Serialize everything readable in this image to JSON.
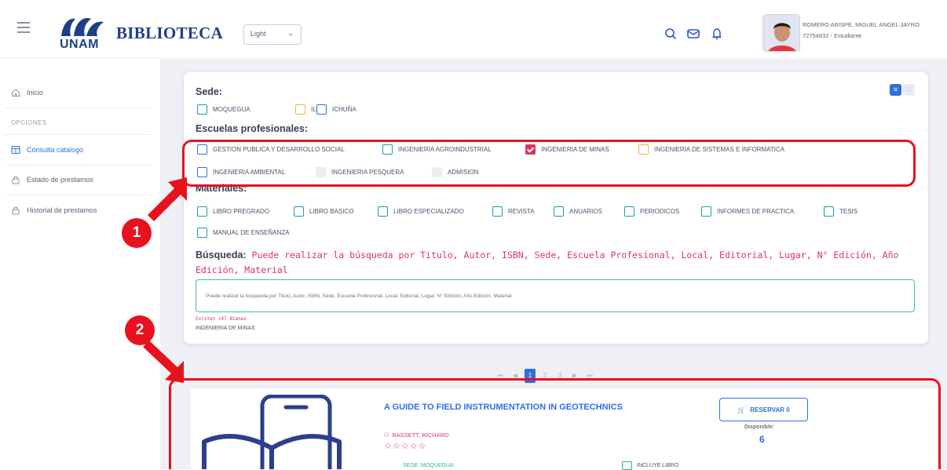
{
  "header": {
    "brand": "BIBLIOTECA",
    "logo_text": "UNAM",
    "theme_select": "Light",
    "user_name": "ROMERO ARISPE, MIGUEL ANGEL JAYRO",
    "user_id": "72754832 - Estudiante",
    "icons": [
      "search-icon",
      "mail-icon",
      "bell-icon"
    ]
  },
  "sidebar": {
    "home": "Inicio",
    "section": "OPCIONES",
    "items": [
      {
        "label": "Consulta catalogo",
        "icon": "catalog-icon",
        "active": true
      },
      {
        "label": "Estado de prestamos",
        "icon": "lock-icon",
        "active": false
      },
      {
        "label": "Historial de prestamos",
        "icon": "lock-icon",
        "active": false
      }
    ]
  },
  "filters": {
    "sede_title": "Sede:",
    "sede": [
      {
        "label": "MOQUEGUA",
        "color": "#1b9bb0"
      },
      {
        "label": "ILO",
        "color": "#f0b44a"
      },
      {
        "label": "ICHUÑA",
        "color": "#2f6fe0"
      }
    ],
    "escuelas_title": "Escuelas profesionales:",
    "escuelas": [
      {
        "label": "GESTION PUBLICA Y DESARROLLO SOCIAL",
        "state": "blue"
      },
      {
        "label": "INGENIERIA AGROINDUSTRIAL",
        "state": "teal"
      },
      {
        "label": "INGENIERIA DE MINAS",
        "state": "checked"
      },
      {
        "label": "INGENIERIA DE SISTEMAS E INFORMATICA",
        "state": "orange"
      },
      {
        "label": "INGENIERIA AMBIENTAL",
        "state": "blue"
      },
      {
        "label": "INGENIERIA PESQUERA",
        "state": "disabled"
      },
      {
        "label": "ADMISION",
        "state": "disabled"
      }
    ],
    "materiales_title": "Materiales:",
    "materiales": [
      "LIBRO PREGRADO",
      "LIBRO BASICO",
      "LIBRO ESPECIALIZADO",
      "REVISTA",
      "ANUARIOS",
      "PERIODICOS",
      "INFORMES DE PRACTICA",
      "TESIS",
      "MANUAL DE ENSEÑANZA"
    ]
  },
  "search": {
    "label": "Búsqueda:",
    "hint": "Puede realizar la búsqueda por Titulo, Autor, ISBN, Sede, Escuela Profesional, Local, Editorial, Lugar, N° Edición, Año Edición, Material",
    "placeholder": "Puede realizar la búsqueda por Titulo, Autor, ISBN, Sede, Escuela Profesional, Local, Editorial, Lugar, N° Edición, Año Edición, Material",
    "count": "Existen 147 Bienes",
    "school": "INGENIERIA DE MINAS"
  },
  "pagination": {
    "pages": [
      "1",
      "2",
      "3"
    ],
    "current": "1"
  },
  "result": {
    "title": "A GUIDE TO FIELD INSTRUMENTATION IN GEOTECHNICS",
    "author": "BASSETT, RICHARD",
    "stars": "☆☆☆☆☆",
    "reserve": "RESERVAR 0",
    "disponible_label": "Disponible:",
    "disponible": "6",
    "sede": "SEDE: MOQUEGUA",
    "incluye": "INCLUYE LIBRO"
  },
  "annotations": {
    "badge1": "1",
    "badge2": "2",
    "color": "#e8121e"
  }
}
